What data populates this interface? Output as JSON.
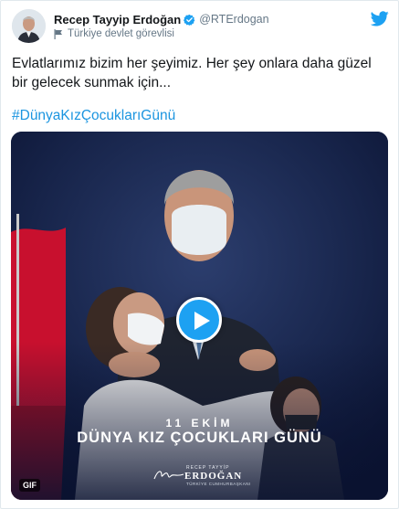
{
  "author": {
    "display_name": "Recep Tayyip Erdoğan",
    "handle": "@RTErdogan",
    "label": "Türkiye devlet görevlisi"
  },
  "tweet": {
    "text": "Evlatlarımız bizim her şeyimiz. Her şey onlara daha güzel bir gelecek sunmak için...",
    "hashtag": "#DünyaKızÇocuklarıGünü"
  },
  "media": {
    "date_line": "11 EKİM",
    "headline": "DÜNYA KIZ ÇOCUKLARI GÜNÜ",
    "logo_top": "RECEP TAYYİP",
    "logo_main": "ERDOĞAN",
    "logo_sub": "TÜRKİYE CUMHURBAŞKANI",
    "badge": "GIF"
  },
  "icons": {
    "verified": "verified-badge-icon",
    "label": "flag-icon",
    "brand": "twitter-bird-icon",
    "play": "play-icon"
  },
  "colors": {
    "link": "#1b95e0",
    "twitter_blue": "#1da1f2",
    "secondary_text": "#657786",
    "media_bg": "#0f1b3a"
  }
}
